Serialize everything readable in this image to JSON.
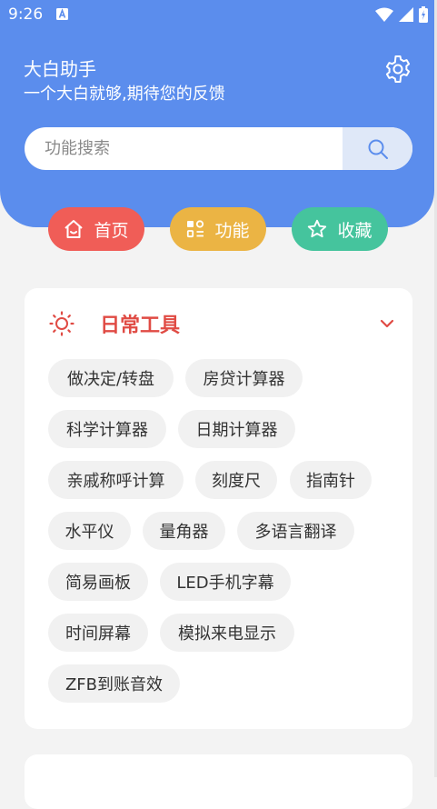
{
  "status": {
    "time": "9:26"
  },
  "header": {
    "title": "大白助手",
    "subtitle": "一个大白就够,期待您的反馈",
    "search_placeholder": "功能搜索"
  },
  "nav": [
    {
      "label": "首页",
      "color": "#f05d57"
    },
    {
      "label": "功能",
      "color": "#ebb444"
    },
    {
      "label": "收藏",
      "color": "#45c49d"
    }
  ],
  "section": {
    "title": "日常工具",
    "items": [
      "做决定/转盘",
      "房贷计算器",
      "科学计算器",
      "日期计算器",
      "亲戚称呼计算",
      "刻度尺",
      "指南针",
      "水平仪",
      "量角器",
      "多语言翻译",
      "简易画板",
      "LED手机字幕",
      "时间屏幕",
      "模拟来电显示",
      "ZFB到账音效"
    ]
  },
  "colors": {
    "header": "#5b8ded",
    "accent": "#e04b44",
    "background": "#f3f3f3"
  }
}
